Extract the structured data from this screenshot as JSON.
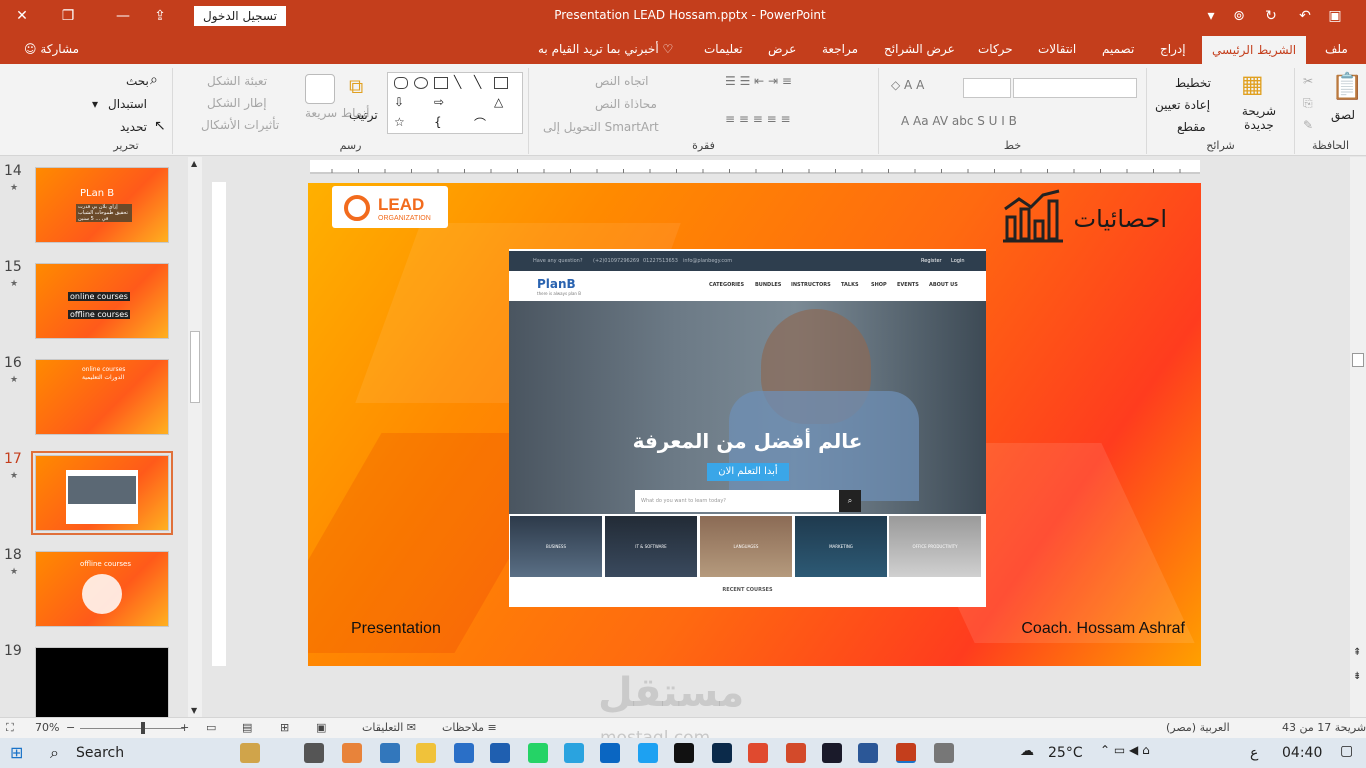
{
  "window": {
    "title": "Presentation LEAD Hossam.pptx  -  PowerPoint",
    "sign_in": "تسجيل الدخول",
    "close_icon": "close-icon",
    "accent": "#c43e1c"
  },
  "tabs": {
    "file": "ملف",
    "home": "الشريط الرئيسي",
    "insert": "إدراج",
    "design": "تصميم",
    "transitions": "انتقالات",
    "animations": "حركات",
    "slideshow": "عرض الشرائح",
    "review": "مراجعة",
    "view": "عرض",
    "help": "تعليمات",
    "tell_me": "أخبرني بما تريد القيام به",
    "share": "مشاركة"
  },
  "ribbon": {
    "paste": "لصق",
    "clipboard": "الحافظة",
    "new_slide": "شريحة جديدة",
    "layout": "تخطيط",
    "reset": "إعادة تعيين",
    "section": "مقطع",
    "slides": "شرائح",
    "font": "خط",
    "paragraph": "فقرة",
    "text_direction": "اتجاه النص",
    "align_text": "محاذاة النص",
    "smartart": "التحويل إلى SmartArt",
    "arrange": "ترتيب",
    "quick_styles": "أنماط سريعة",
    "shape_fill": "تعبئة الشكل",
    "shape_outline": "إطار الشكل",
    "shape_effects": "تأثيرات الأشكال",
    "drawing": "رسم",
    "find": "بحث",
    "replace": "استبدال",
    "select": "تحديد",
    "editing": "تحرير"
  },
  "thumbs": [
    {
      "num": "14",
      "text": "PLan B",
      "sub": "إزاي بلان بي قدرت تحقيق طموحات الشباب في ... 5 سنين"
    },
    {
      "num": "15",
      "text": "online courses",
      "sub": "offline courses"
    },
    {
      "num": "16",
      "text": "online courses",
      "sub": "الدورات التعليمية"
    },
    {
      "num": "17",
      "text": "",
      "sub": ""
    },
    {
      "num": "18",
      "text": "offline courses",
      "sub": ""
    },
    {
      "num": "19",
      "text": "",
      "sub": ""
    }
  ],
  "slide": {
    "logo_main": "LEAD",
    "logo_sub": "ORGANIZATION",
    "stat_title": "احصائيات",
    "website": {
      "top_question": "Have any question?",
      "phone1": "(+2)01097296269",
      "phone2": "01227513653",
      "email": "info@planbegy.com",
      "register": "Register",
      "login": "Login",
      "brand": "PlanB",
      "brand_tag": "there is always plan B",
      "nav": [
        "CATEGORIES",
        "BUNDLES",
        "INSTRUCTORS",
        "TALKS",
        "SHOP",
        "EVENTS",
        "ABOUT US"
      ],
      "hero_title": "عالم أفضل من المعرفة",
      "hero_button": "أبدا التعلم الان",
      "search_placeholder": "What do you want to learn today?",
      "categories": [
        "BUSINESS",
        "IT & SOFTWARE",
        "LANGUAGES",
        "MARKETING",
        "OFFICE PRODUCTIVITY"
      ],
      "recent": "RECENT COURSES"
    },
    "footer_left": "Presentation",
    "footer_right": "Coach. Hossam Ashraf"
  },
  "status": {
    "slide_info": "شريحة 17 من 43",
    "language": "العربية (مصر)",
    "notes": "ملاحظات",
    "comments": "التعليقات",
    "zoom": "70%"
  },
  "taskbar": {
    "search": "Search",
    "temp": "25°C",
    "time": "04:40",
    "lang": "ع"
  },
  "watermark": {
    "main": "مستقل",
    "domain": "mostaql.com"
  }
}
